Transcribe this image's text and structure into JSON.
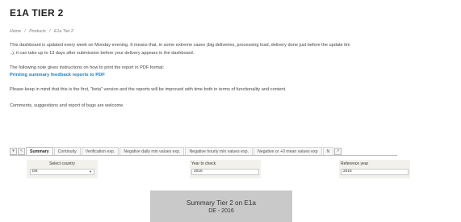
{
  "page": {
    "title": "E1A TIER 2",
    "breadcrumb": [
      "Home",
      "/",
      "Products",
      "/",
      "E1a Tier 2"
    ]
  },
  "content": {
    "para1_line1": "This dashboard is updated every week on Monday evening. It means that, in some extreme cases (big deliveries, processing load, delivery done just before the update tim",
    "para1_line2": "..), it can take up to 13 days after submission before your delivery appears in the dashboard.",
    "para2": "The following note gives instructions on how to print the report in PDF format:",
    "link_text": "Printing summary feedback reports to PDF",
    "para3": "Please keep in mind that this is the first, \"beta\" version and the reports will be improved with time both in terms of functionality and content.",
    "para4": "Comments, suggestions and report of bugs are welcome."
  },
  "tabs": {
    "nav_left_1": "▾",
    "nav_left_2": "<",
    "items": [
      "Summary",
      "Continuity",
      "Verification exp.",
      "Negative daily min values exp.",
      "Negative hourly min values exp.",
      "Negative or +0 mean values exp",
      "N"
    ],
    "nav_right": ">"
  },
  "filters": {
    "country": {
      "label": "Select country",
      "value": "DE"
    },
    "year": {
      "label": "Year to check",
      "value": "2016"
    },
    "reference": {
      "label": "Reference year",
      "value": "2015"
    }
  },
  "summary": {
    "title": "Summary Tier 2 on E1a",
    "subtitle": "DE - 2016"
  }
}
